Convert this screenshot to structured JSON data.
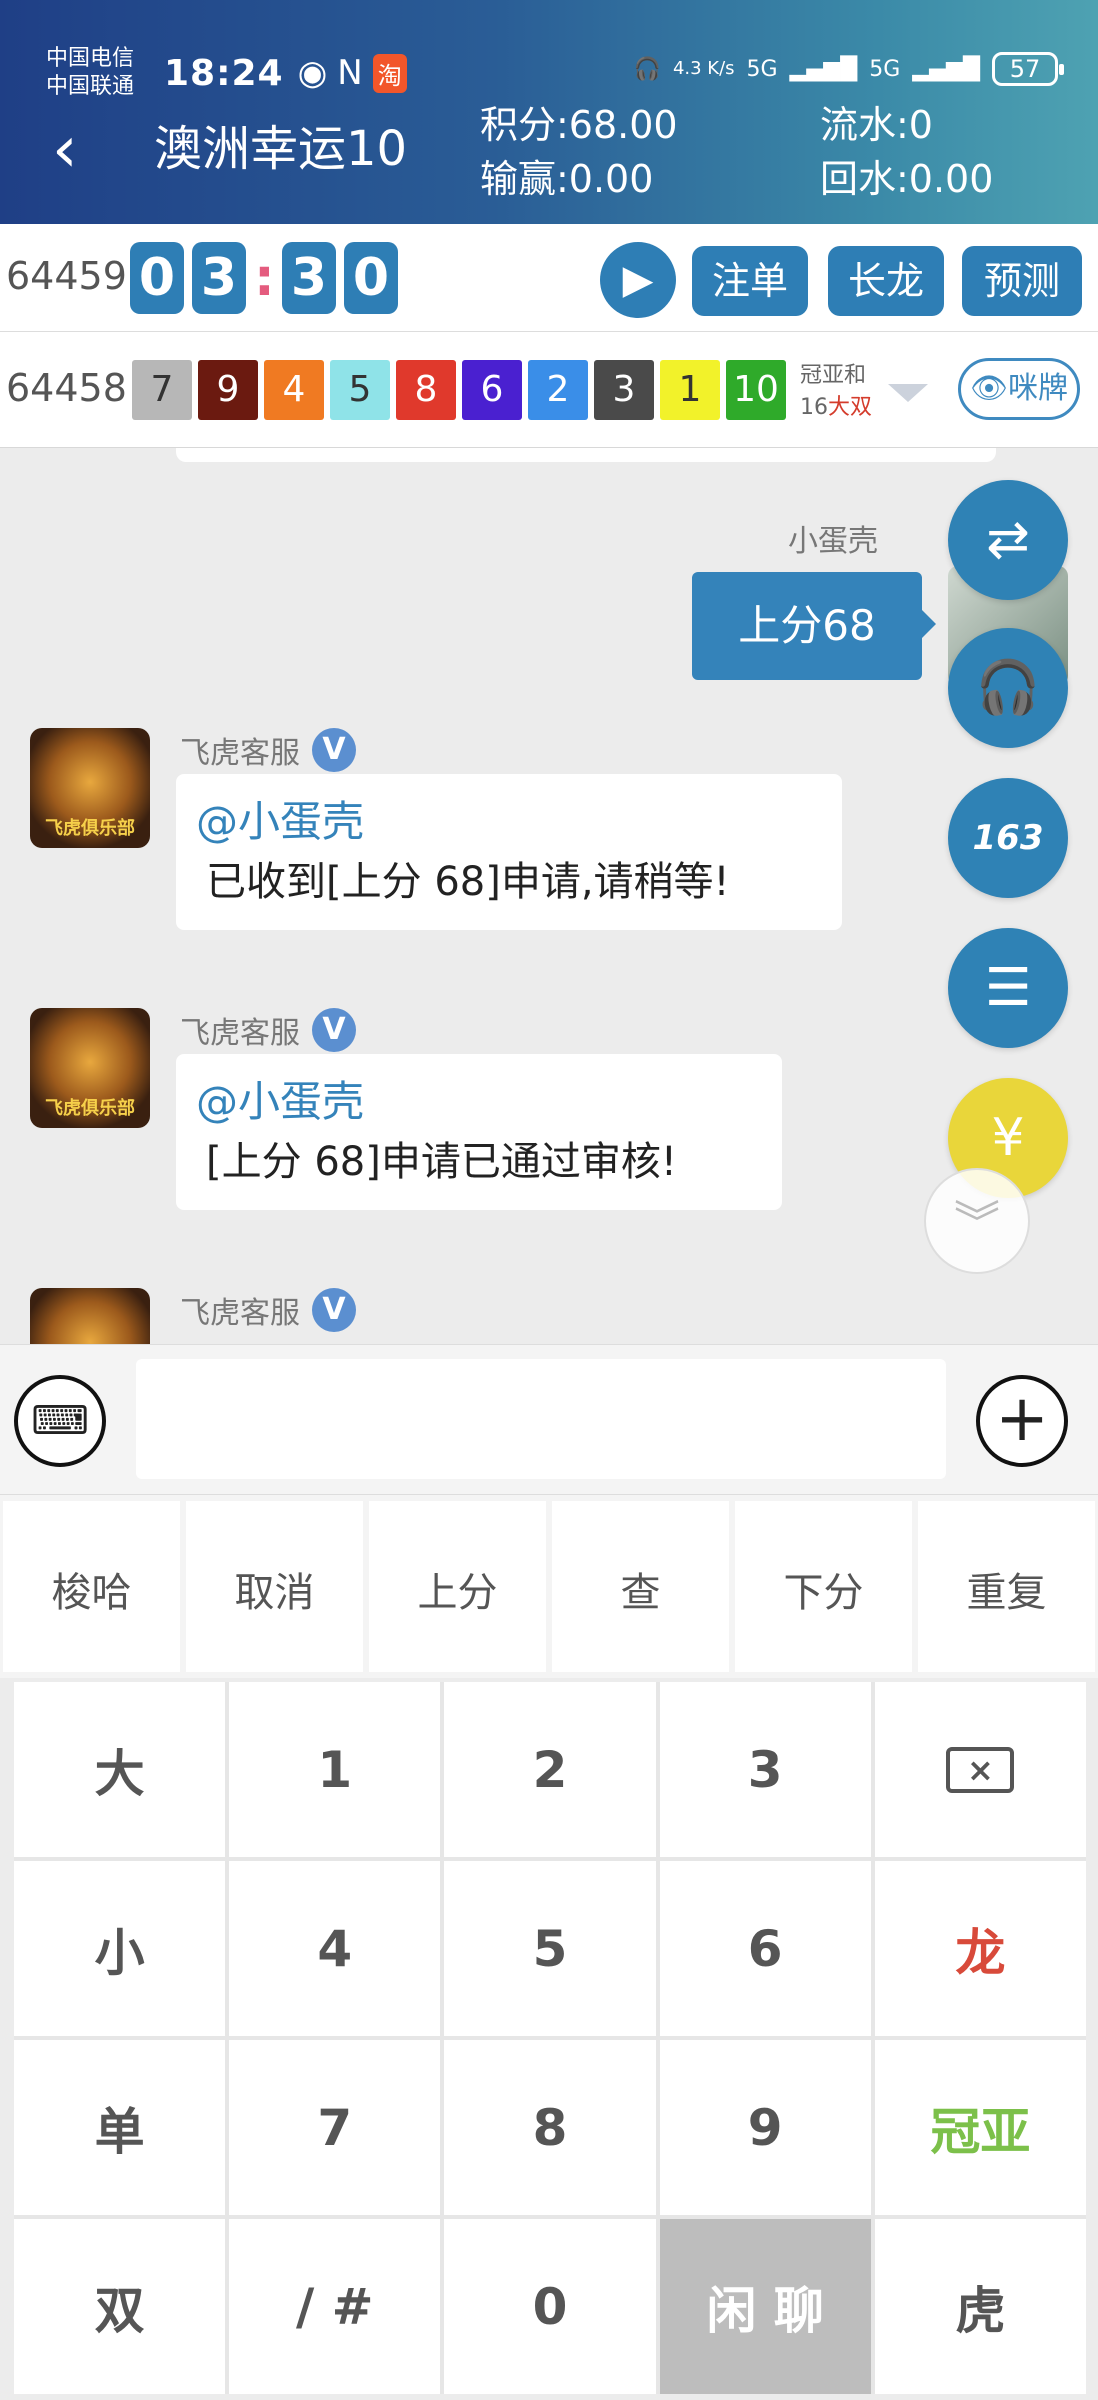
{
  "status_bar": {
    "carrier1": "中国电信",
    "carrier2": "中国联通",
    "time": "18:24",
    "speed": "4.3 K/s",
    "sig1": "5G",
    "sig2": "5G",
    "battery": "57"
  },
  "header": {
    "back_icon": "‹",
    "title": "澳洲幸运10",
    "points": "积分:68.00",
    "flow": "流水:0",
    "win_loss": "输赢:0.00",
    "rebate": "回水:0.00"
  },
  "current_round": {
    "issue": "64459",
    "countdown": [
      "0",
      "3",
      "3",
      "0"
    ],
    "buttons": [
      "注单",
      "长龙",
      "预测"
    ]
  },
  "last_round": {
    "issue": "64458",
    "balls": [
      {
        "n": "7",
        "color": "#b7b7b7",
        "text": "#333"
      },
      {
        "n": "9",
        "color": "#6b1a10",
        "text": "#fff"
      },
      {
        "n": "4",
        "color": "#f07a22",
        "text": "#fff"
      },
      {
        "n": "5",
        "color": "#8fe3e8",
        "text": "#333"
      },
      {
        "n": "8",
        "color": "#e0392c",
        "text": "#fff"
      },
      {
        "n": "6",
        "color": "#4a20d0",
        "text": "#fff"
      },
      {
        "n": "2",
        "color": "#3a8ee8",
        "text": "#fff"
      },
      {
        "n": "3",
        "color": "#4a4a4a",
        "text": "#fff"
      },
      {
        "n": "1",
        "color": "#f2f22a",
        "text": "#333"
      },
      {
        "n": "10",
        "color": "#2faa2a",
        "text": "#fff"
      }
    ],
    "sum_label": "冠亚和",
    "sum_value": "16",
    "sum_result": "大双",
    "mipai": "咪牌"
  },
  "chat": {
    "me_name": "小蛋壳",
    "me_message": "上分68",
    "messages": [
      {
        "sender": "飞虎客服",
        "at": "@小蛋壳",
        "text": "已收到[上分 68]申请,请稍等!"
      },
      {
        "sender": "飞虎客服",
        "at": "@小蛋壳",
        "text": "[上分 68]申请已通过审核!"
      },
      {
        "sender": "飞虎客服"
      }
    ],
    "avatar_text": "飞虎俱乐部"
  },
  "fabs": {
    "swap_icon": "⇄",
    "service_icon": "🎧",
    "b163": "163",
    "list_icon": "☰",
    "home_icon": "¥"
  },
  "quick_actions": [
    "梭哈",
    "取消",
    "上分",
    "查",
    "下分",
    "重复"
  ],
  "keypad": [
    [
      "大",
      "1",
      "2",
      "3",
      "⌫"
    ],
    [
      "小",
      "4",
      "5",
      "6",
      "龙"
    ],
    [
      "单",
      "7",
      "8",
      "9",
      "冠亚"
    ],
    [
      "双",
      "/ #",
      "0",
      "闲 聊",
      "虎"
    ]
  ],
  "colors": {
    "accent": "#2e7eb5",
    "dragon": "#d84a3a",
    "guanya": "#7cc04a"
  }
}
